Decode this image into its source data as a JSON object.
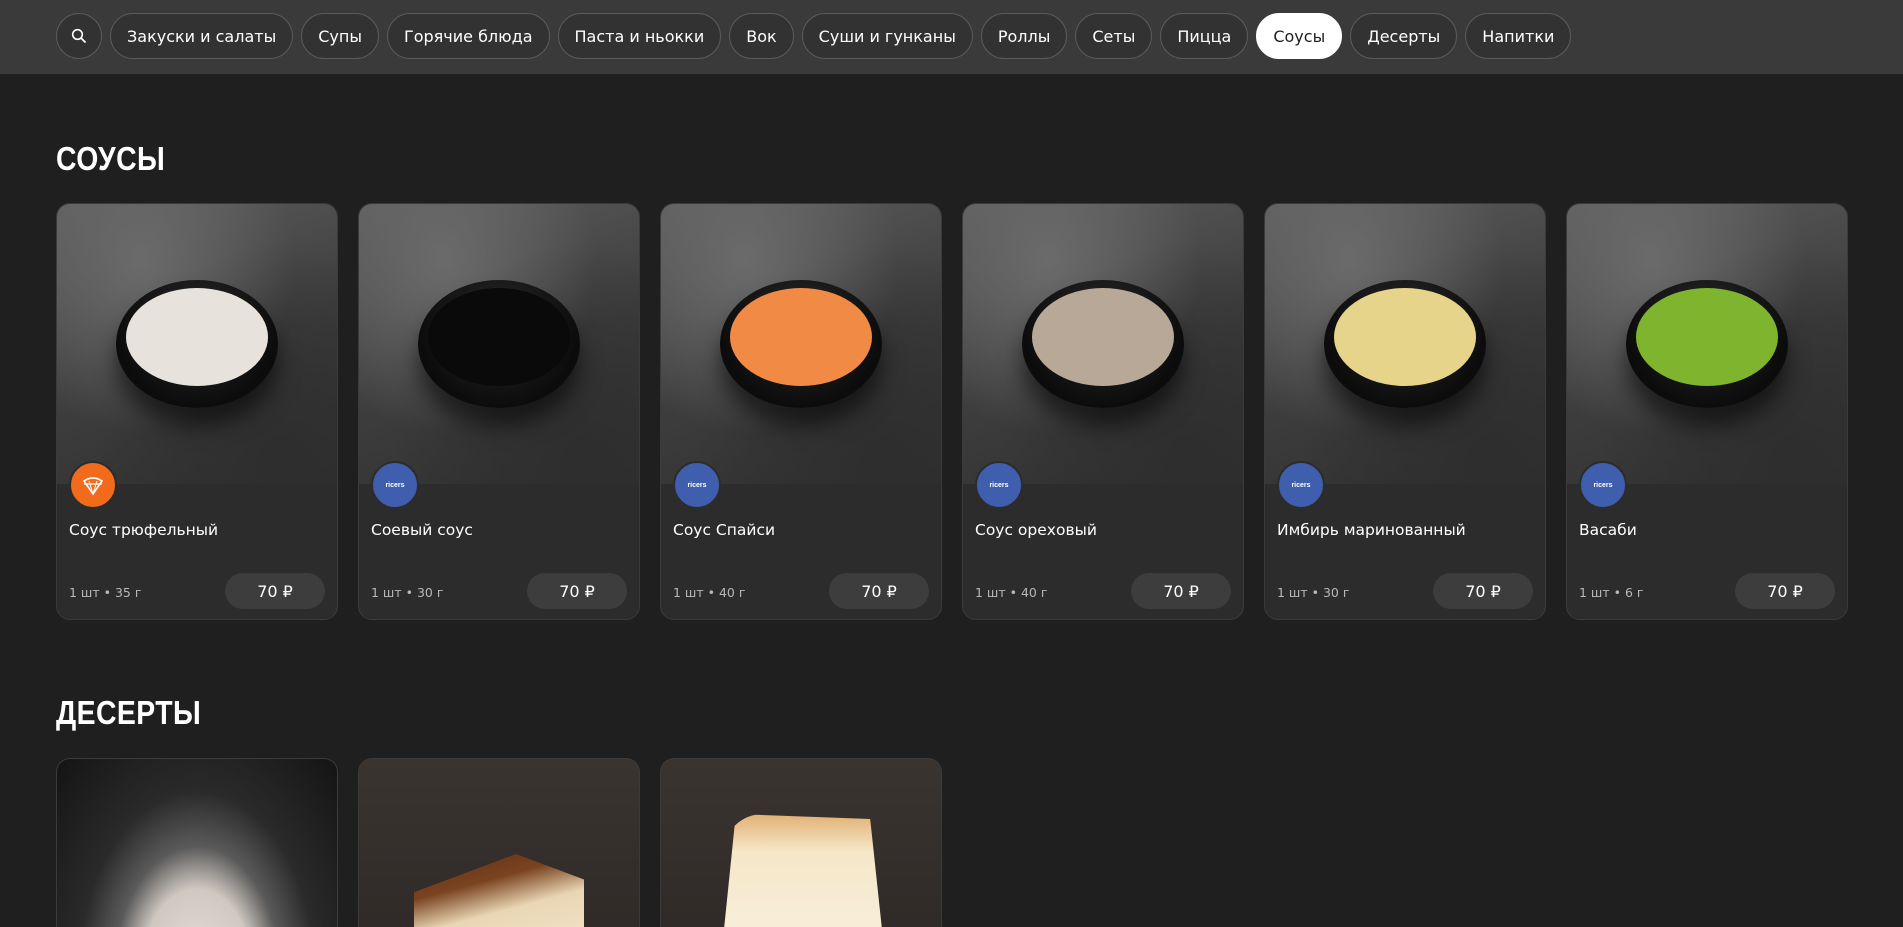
{
  "nav": {
    "search_icon": "search-icon",
    "categories": [
      {
        "label": "Закуски и салаты",
        "active": false
      },
      {
        "label": "Супы",
        "active": false
      },
      {
        "label": "Горячие блюда",
        "active": false
      },
      {
        "label": "Паста и ньокки",
        "active": false
      },
      {
        "label": "Вок",
        "active": false
      },
      {
        "label": "Суши и гунканы",
        "active": false
      },
      {
        "label": "Роллы",
        "active": false
      },
      {
        "label": "Сеты",
        "active": false
      },
      {
        "label": "Пицца",
        "active": false
      },
      {
        "label": "Соусы",
        "active": true
      },
      {
        "label": "Десерты",
        "active": false
      },
      {
        "label": "Напитки",
        "active": false
      }
    ]
  },
  "sections": {
    "sauces": {
      "title": "Соусы",
      "items": [
        {
          "name": "Соус трюфельный",
          "meta": "1 шт • 35 г",
          "price": "70 ₽",
          "brand": "",
          "brand_color": "#f26a1b",
          "sauce_color": "#e8e2dc"
        },
        {
          "name": "Соевый соус",
          "meta": "1 шт • 30 г",
          "price": "70 ₽",
          "brand": "ricers",
          "brand_color": "#3f5fae",
          "sauce_color": "#0a0a0a"
        },
        {
          "name": "Соус Спайси",
          "meta": "1 шт • 40 г",
          "price": "70 ₽",
          "brand": "ricers",
          "brand_color": "#3f5fae",
          "sauce_color": "#f08a45"
        },
        {
          "name": "Соус ореховый",
          "meta": "1 шт • 40 г",
          "price": "70 ₽",
          "brand": "ricers",
          "brand_color": "#3f5fae",
          "sauce_color": "#b8a898"
        },
        {
          "name": "Имбирь маринованный",
          "meta": "1 шт • 30 г",
          "price": "70 ₽",
          "brand": "ricers",
          "brand_color": "#3f5fae",
          "sauce_color": "#e6d48a"
        },
        {
          "name": "Васаби",
          "meta": "1 шт • 6 г",
          "price": "70 ₽",
          "brand": "ricers",
          "brand_color": "#3f5fae",
          "sauce_color": "#7fb52e"
        }
      ]
    },
    "desserts": {
      "title": "Десерты"
    }
  },
  "colors": {
    "background": "#1f1f1f",
    "topbar": "#3a3a3a",
    "card": "#2c2c2c",
    "active_chip": "#ffffff"
  }
}
